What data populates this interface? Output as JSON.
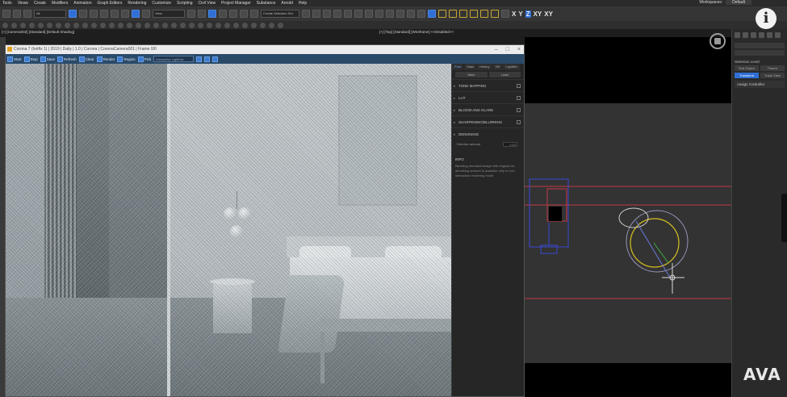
{
  "menu": [
    "Tools",
    "Views",
    "Create",
    "Modifiers",
    "Animation",
    "Graph Editors",
    "Rendering",
    "Customize",
    "Scripting",
    "Civil View",
    "Project Manager",
    "Substance",
    "Arnold",
    "Help"
  ],
  "workspace": {
    "label": "Workspaces:",
    "value": "Default"
  },
  "toolbar": {
    "filter_all": "All",
    "view_select": "View",
    "selection_set": "Create Selection Set",
    "axes": [
      "X",
      "Y",
      "Z",
      "XY",
      "XY"
    ],
    "active_axis": "Z"
  },
  "viewports": {
    "left_label": "[+] [Camera002] [Standard] [Default Shading]",
    "right_label": "[+] [Top] [Standard] [Wireframe]",
    "right_label_extra": "<<Disabled>>"
  },
  "vfb": {
    "title": "Corona 7 (hotfix 1) | 2019 | Daily | 1.0 | Corona | CoronaCamera001 | Frame 0/0",
    "tools": [
      "Start",
      "Stop",
      "Save",
      "Refresh",
      "Clear",
      "Render",
      "Region",
      "Pick"
    ],
    "mode_select": "Interactive LightMix",
    "panel_tabs": [
      "Post",
      "Stats",
      "History",
      "DR",
      "LightMix"
    ],
    "panel_buttons": [
      "Save",
      "Load"
    ],
    "sections": [
      "TONE MAPPING",
      "LUT",
      "BLOOM AND GLARE",
      "SHARPENING/BLURRING",
      "DENOISING"
    ],
    "denoise_label": "Denoise amount",
    "denoise_value": "0.65",
    "info_header": "INFO",
    "info_text": "Blending denoised image with original via denoising amount is available only in non-interactive rendering mode"
  },
  "command_panel": {
    "section": "Selection Level:",
    "buttons": [
      "Sub-Object",
      "Parent",
      "Transform",
      "Track View"
    ],
    "rollout": "Assign Controller"
  },
  "overlay": {
    "info_glyph": "i",
    "logo": "AVA"
  },
  "colors": {
    "accent_blue": "#2f6fd6",
    "viewport_bg": "#333333",
    "wire_red": "#c23a4a",
    "wire_blue": "#3a4ad6",
    "wire_yellow": "#d8c020"
  }
}
